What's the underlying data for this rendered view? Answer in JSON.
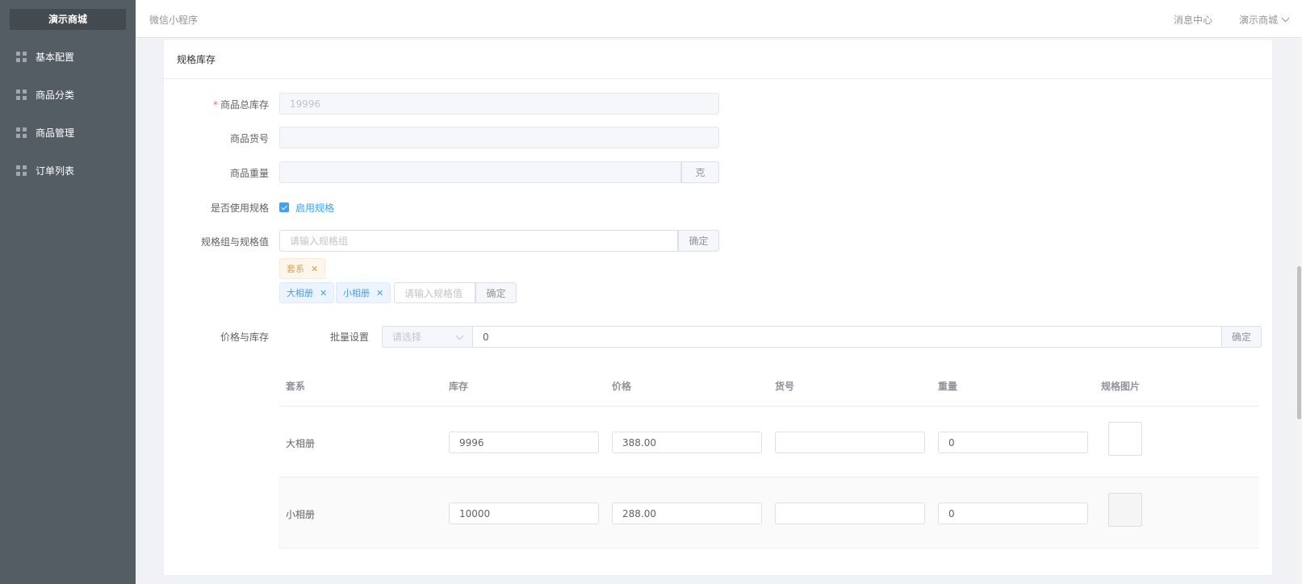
{
  "sidebar": {
    "brand": "演示商城",
    "items": [
      {
        "label": "基本配置"
      },
      {
        "label": "商品分类"
      },
      {
        "label": "商品管理"
      },
      {
        "label": "订单列表"
      }
    ]
  },
  "header": {
    "title": "微信小程序",
    "message_center": "消息中心",
    "user": "演示商城"
  },
  "card": {
    "title": "规格库存"
  },
  "form": {
    "total_stock": {
      "label": "商品总库存",
      "value": "19996"
    },
    "sku_no": {
      "label": "商品货号",
      "value": ""
    },
    "weight": {
      "label": "商品重量",
      "value": "",
      "unit": "克"
    },
    "use_spec": {
      "label": "是否使用规格",
      "checkbox_label": "启用规格",
      "checked": true
    },
    "spec_group": {
      "label": "规格组与规格值",
      "placeholder": "请输入规格组",
      "confirm": "确定"
    },
    "groups": [
      {
        "name": "套系",
        "values": [
          "大相册",
          "小相册"
        ],
        "value_placeholder": "请输入规格值",
        "value_confirm": "确定"
      }
    ],
    "price_stock": {
      "label": "价格与库存",
      "batch_label": "批量设置",
      "select_placeholder": "请选择",
      "batch_value": "0",
      "batch_confirm": "确定"
    }
  },
  "table": {
    "columns": [
      "套系",
      "库存",
      "价格",
      "货号",
      "重量",
      "规格图片"
    ],
    "rows": [
      {
        "spec": "大相册",
        "stock": "9996",
        "price": "388.00",
        "sku": "",
        "weight": "0"
      },
      {
        "spec": "小相册",
        "stock": "10000",
        "price": "288.00",
        "sku": "",
        "weight": "0"
      }
    ]
  },
  "colors": {
    "sidebar_bg": "#545c64",
    "primary": "#409eff",
    "warning": "#e6a23c",
    "required": "#f56c6c"
  }
}
